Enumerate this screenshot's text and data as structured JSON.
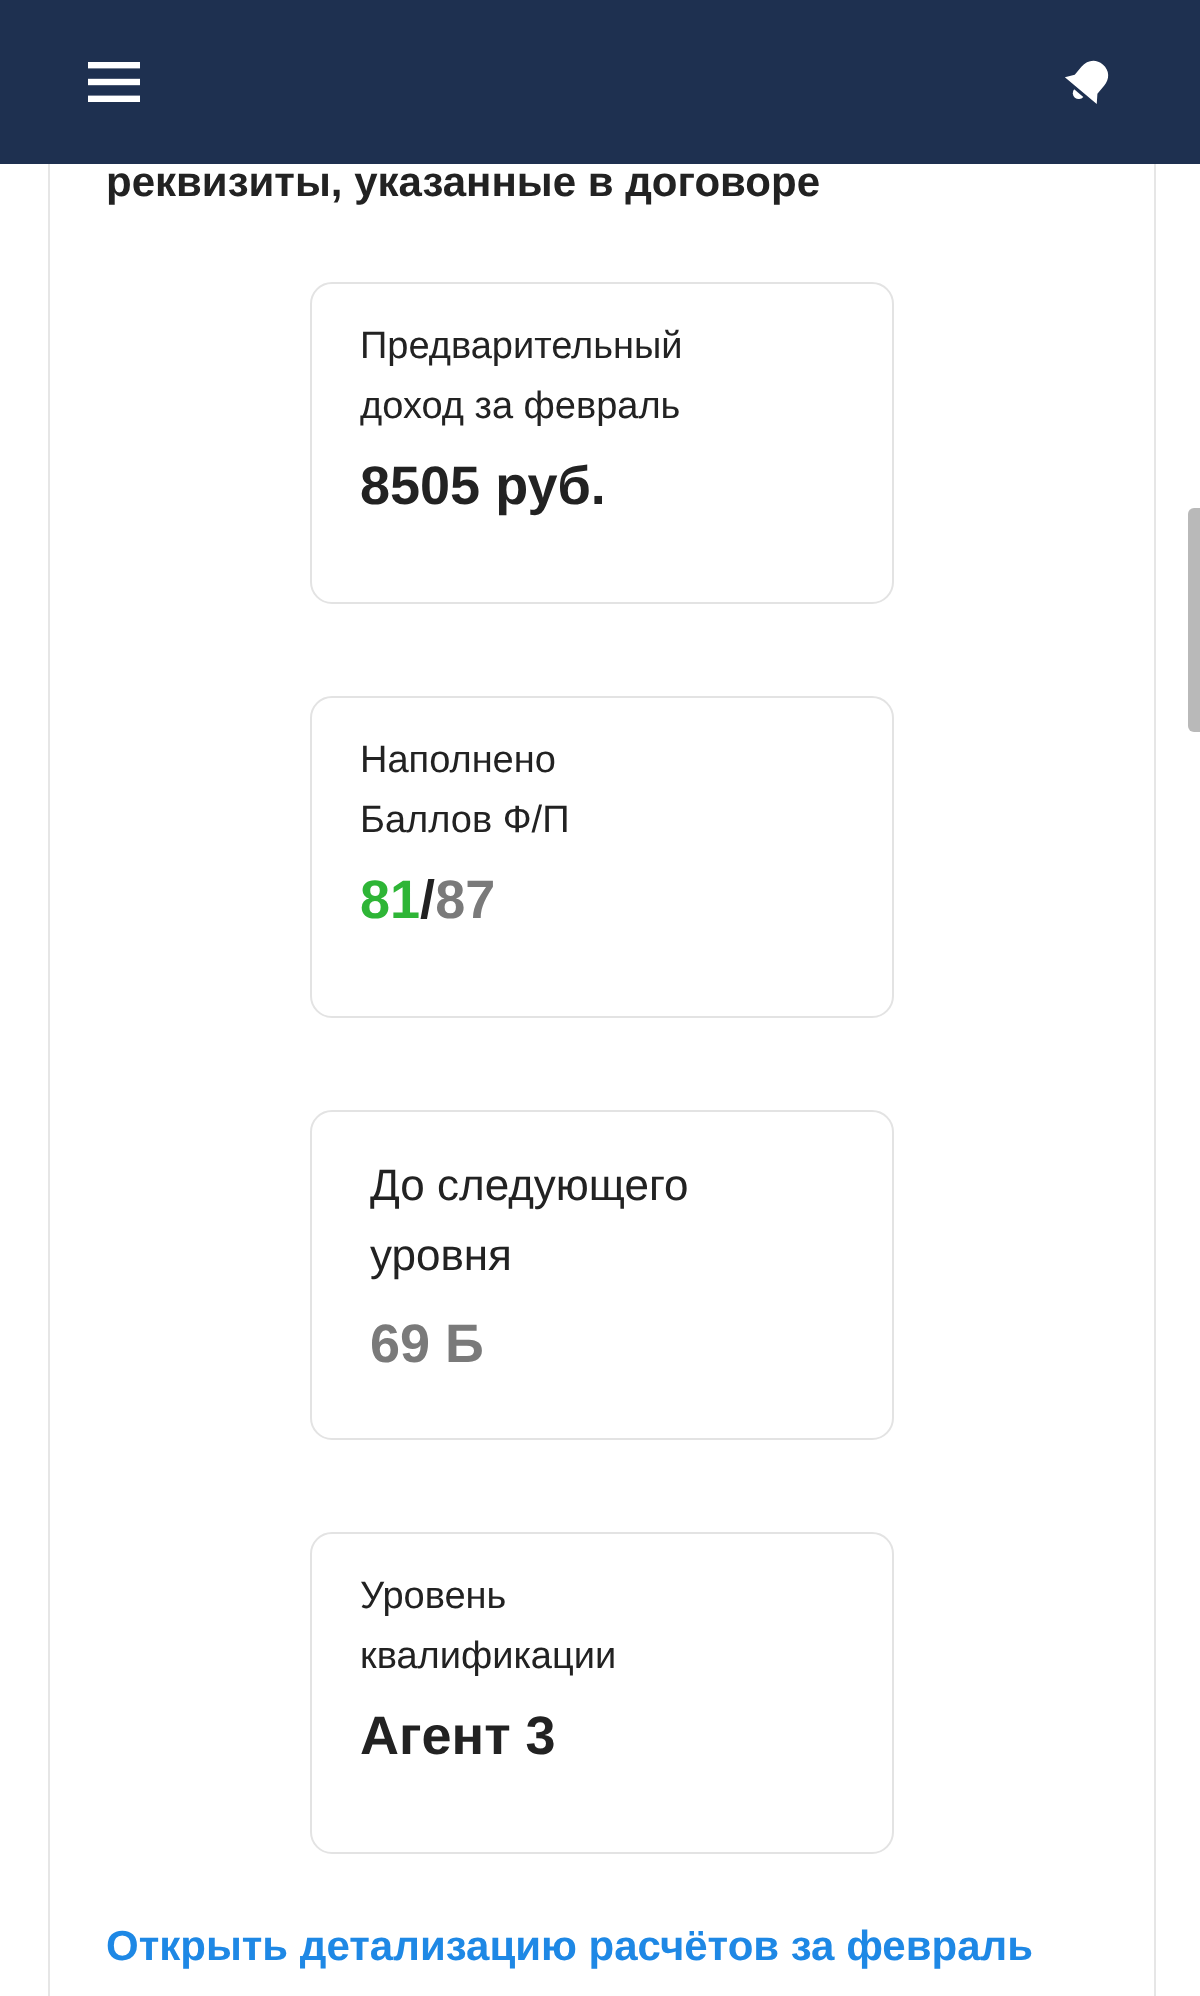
{
  "section": {
    "heading": "реквизиты, указанные в договоре",
    "cards": [
      {
        "kind": "standard",
        "label": "Предварительный\nдоход за февраль",
        "value_parts": [
          {
            "text": "8505 руб.",
            "color": "#222222"
          }
        ]
      },
      {
        "kind": "standard",
        "label": "Наполнено\nБаллов Ф/П",
        "value_parts": [
          {
            "text": "81",
            "color": "#2eb536"
          },
          {
            "text": "/",
            "color": "#222222"
          },
          {
            "text": "87",
            "color": "#7a7a7a"
          }
        ]
      },
      {
        "kind": "large",
        "label": "До следующего\nуровня",
        "value_parts": [
          {
            "text": "69 Б",
            "color": "#7a7a7a"
          }
        ]
      },
      {
        "kind": "standard",
        "label": "Уровень\nквалификации",
        "value_parts": [
          {
            "text": "Агент 3",
            "color": "#222222"
          }
        ]
      }
    ],
    "link": "Открыть детализацию расчётов за февраль"
  }
}
